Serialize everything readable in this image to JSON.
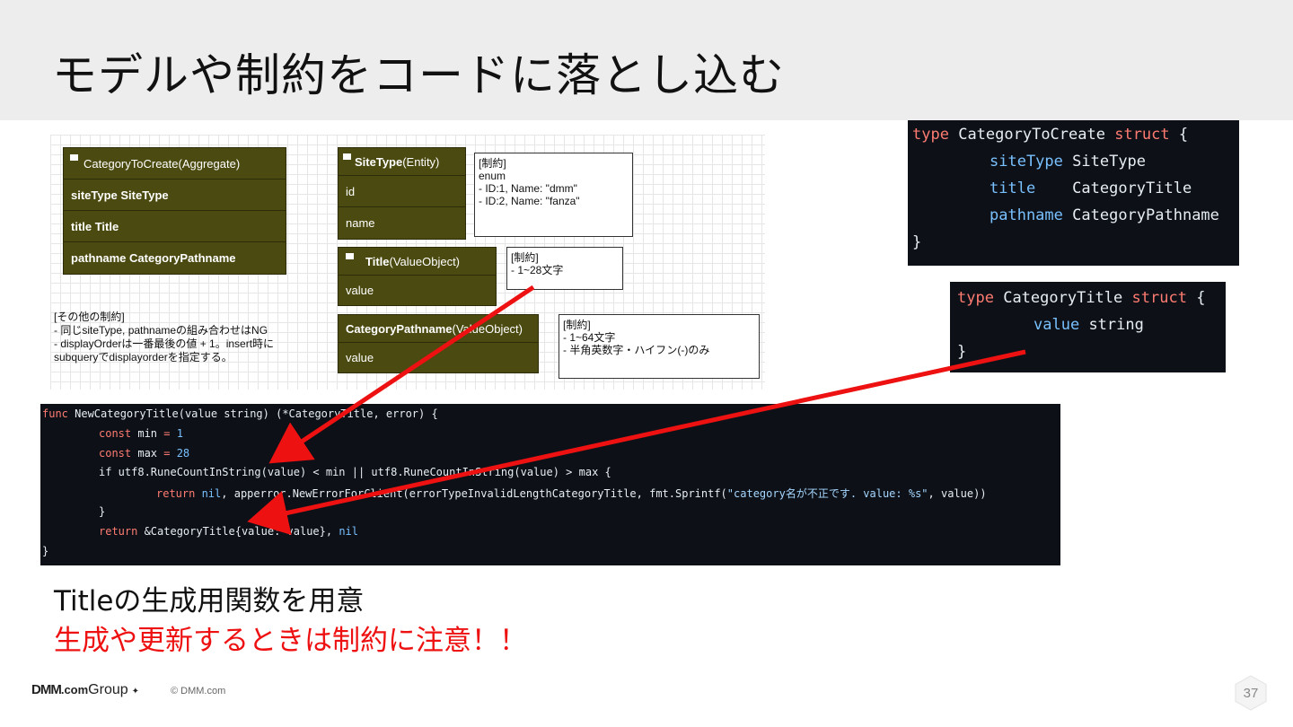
{
  "title": "モデルや制約をコードに落とし込む",
  "diagram": {
    "aggregate": {
      "header": "CategoryToCreate(Aggregate)",
      "rows": [
        "siteType SiteType",
        "title Title",
        "pathname CategoryPathname"
      ]
    },
    "sitetype": {
      "header_bold": "SiteType",
      "header_rest": "(Entity)",
      "rows": [
        "id",
        "name"
      ]
    },
    "sitetype_note": [
      "[制約]",
      "enum",
      "- ID:1, Name: \"dmm\"",
      "- ID:2, Name: \"fanza\""
    ],
    "titlevo": {
      "header_bold": "Title",
      "header_rest": "(ValueObject)",
      "rows": [
        "value"
      ]
    },
    "title_note": [
      "[制約]",
      "- 1~28文字"
    ],
    "pathnamevo": {
      "header_bold": "CategoryPathname",
      "header_rest": "(ValueObject)",
      "rows": [
        "value"
      ]
    },
    "pathname_note": [
      "[制約]",
      "- 1~64文字",
      "- 半角英数字・ハイフン(-)のみ"
    ],
    "other_constraints": [
      "[その他の制約]",
      "- 同じsiteType, pathnameの組み合わせはNG",
      "- displayOrderは一番最後の値 + 1。insert時に",
      "subqueryでdisplayorderを指定する。"
    ]
  },
  "code_struct1": {
    "kw_type": "type",
    "name": "CategoryToCreate",
    "kw_struct": "struct",
    "open": "{",
    "fields": [
      {
        "name": "siteType",
        "type": "SiteType"
      },
      {
        "name": "title",
        "type": "CategoryTitle"
      },
      {
        "name": "pathname",
        "type": "CategoryPathname"
      }
    ],
    "close": "}"
  },
  "code_struct2": {
    "kw_type": "type",
    "name": "CategoryTitle",
    "kw_struct": "struct",
    "open": "{",
    "field_name": "value",
    "field_type": "string",
    "close": "}"
  },
  "code_func": {
    "line1_kw": "func",
    "line1_rest": " NewCategoryTitle(value string) (*CategoryTitle, error) {",
    "line2_kw": "const",
    "line2_name": " min ",
    "line2_op": "=",
    "line2_val": " 1",
    "line3_kw": "const",
    "line3_name": " max ",
    "line3_op": "=",
    "line3_val": " 28",
    "line4": "if utf8.RuneCountInString(value) < min || utf8.RuneCountInString(value) > max {",
    "line5_kw": "return",
    "line5_nil": " nil",
    "line5_rest": ", apperror.NewErrorForClient(errorTypeInvalidLengthCategoryTitle, fmt.Sprintf(",
    "line5_str": "\"category名が不正です. value: %s\"",
    "line5_end": ", value))",
    "line6": "}",
    "line7_kw": "return",
    "line7_rest": " &CategoryTitle{value: value},",
    "line7_nil": " nil",
    "line8": "}"
  },
  "subtitle1": "Titleの生成用関数を用意",
  "subtitle2": "生成や更新するときは制約に注意！！",
  "footer": {
    "logo_bold": "DMM",
    "logo_dot": ".com",
    "logo_group": "Group",
    "copyright": "© DMM.com"
  },
  "page_number": "37",
  "colors": {
    "arrow": "#ee1111",
    "entity": "#4b4a10",
    "code_bg": "#0d1117",
    "keyword": "#ff7b72",
    "field": "#79c0ff"
  }
}
